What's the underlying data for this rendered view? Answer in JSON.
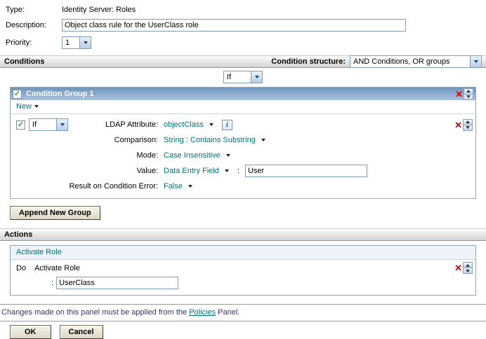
{
  "colors": {
    "group_header_blue": "#6d96c0",
    "link_teal": "#007272",
    "delete_red": "#cc0000",
    "section_bar_gray": "#d2d2d2"
  },
  "icons": {
    "check": "✓",
    "delete": "✕",
    "info": "i"
  },
  "form": {
    "type_label": "Type:",
    "type_value": "Identity Server: Roles",
    "description_label": "Description:",
    "description_value": "Object class rule for the UserClass role",
    "priority_label": "Priority:",
    "priority_value": "1"
  },
  "conditions": {
    "section_title": "Conditions",
    "structure_label": "Condition structure:",
    "structure_value": "AND Conditions, OR groups",
    "if_value": "If",
    "group": {
      "title": "Condition Group 1",
      "new_label": "New"
    },
    "condition": {
      "if_value": "If",
      "attribute_label": "LDAP Attribute:",
      "attribute_value": "objectClass",
      "comparison_label": "Comparison:",
      "comparison_value": "String : Contains Substring",
      "mode_label": "Mode:",
      "mode_value": "Case Insensitive",
      "value_label": "Value:",
      "value_mode": "Data Entry Field",
      "value_separator": ":",
      "value_text": "User",
      "result_label": "Result on Condition Error:",
      "result_value": "False"
    },
    "append_group_button": "Append New Group"
  },
  "actions": {
    "section_title": "Actions",
    "group_title": "Activate Role",
    "do_label": "Do",
    "action_name": "Activate Role",
    "value_separator": ":",
    "value_text": "UserClass"
  },
  "footer": {
    "note_before": "Changes made on this panel must be applied from the ",
    "policies_link": "Policies",
    "note_after": " Panel.",
    "ok_button": "OK",
    "cancel_button": "Cancel"
  }
}
